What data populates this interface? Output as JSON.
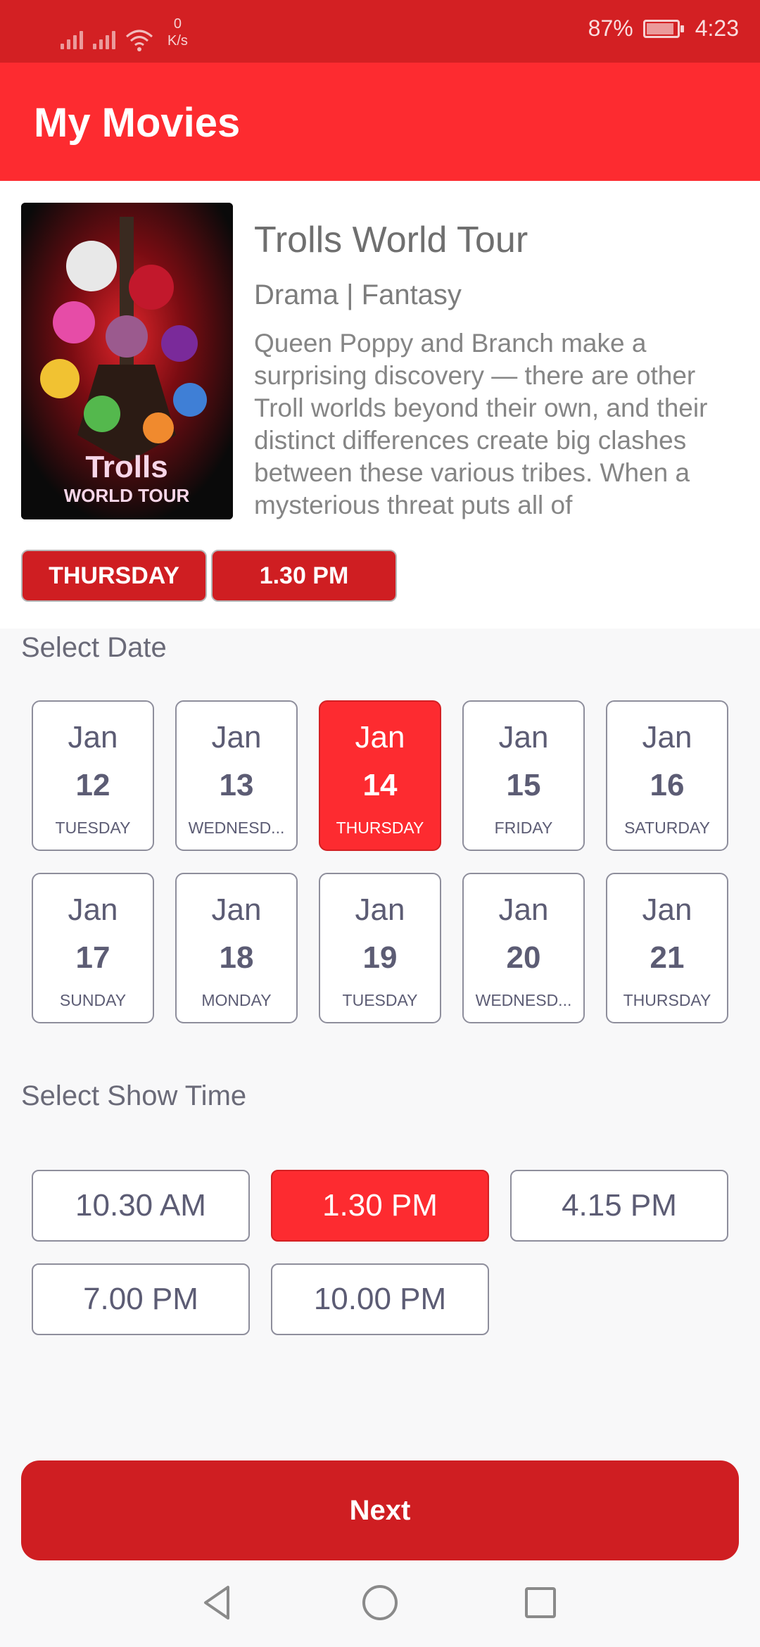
{
  "status_bar": {
    "net_speed_value": "0",
    "net_speed_unit": "K/s",
    "battery": "87%",
    "time": "4:23"
  },
  "app_bar": {
    "title": "My Movies"
  },
  "movie": {
    "poster_title": "Trolls",
    "poster_subtitle": "WORLD TOUR",
    "title": "Trolls World Tour",
    "genre": "Drama | Fantasy",
    "description": "Queen Poppy and Branch make a surprising discovery — there are other Troll worlds beyond their own, and their distinct differences create big clashes between these various tribes. When a mysterious threat puts all of",
    "selected_day": "THURSDAY",
    "selected_time": "1.30 PM"
  },
  "date_section": {
    "label": "Select Date",
    "dates": [
      {
        "month": "Jan",
        "day": "12",
        "weekday": "TUESDAY"
      },
      {
        "month": "Jan",
        "day": "13",
        "weekday": "WEDNESD..."
      },
      {
        "month": "Jan",
        "day": "14",
        "weekday": "THURSDAY"
      },
      {
        "month": "Jan",
        "day": "15",
        "weekday": "FRIDAY"
      },
      {
        "month": "Jan",
        "day": "16",
        "weekday": "SATURDAY"
      },
      {
        "month": "Jan",
        "day": "17",
        "weekday": "SUNDAY"
      },
      {
        "month": "Jan",
        "day": "18",
        "weekday": "MONDAY"
      },
      {
        "month": "Jan",
        "day": "19",
        "weekday": "TUESDAY"
      },
      {
        "month": "Jan",
        "day": "20",
        "weekday": "WEDNESD..."
      },
      {
        "month": "Jan",
        "day": "21",
        "weekday": "THURSDAY"
      }
    ]
  },
  "time_section": {
    "label": "Select Show Time",
    "times": [
      "10.30 AM",
      "1.30 PM",
      "4.15 PM",
      "7.00 PM",
      "10.00 PM"
    ]
  },
  "next_button": {
    "label": "Next"
  },
  "colors": {
    "status_bar": "#d32023",
    "app_bar": "#fd2b30",
    "selected": "#fd2b30",
    "chip": "#cf1e22",
    "next_button": "#cf1e22"
  }
}
